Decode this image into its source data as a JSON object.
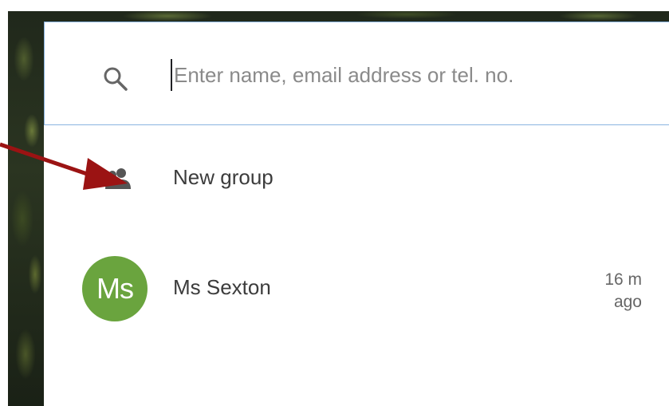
{
  "search": {
    "placeholder": "Enter name, email address or tel. no."
  },
  "new_group": {
    "label": "New group",
    "icon": "group-icon"
  },
  "contacts": [
    {
      "initials": "Ms",
      "name": "Ms Sexton",
      "time_line1": "16 m",
      "time_line2": "ago",
      "avatar_color": "#6aa43e"
    }
  ],
  "colors": {
    "accent_border": "#8ab4e0",
    "annotation_arrow": "#9b1313"
  }
}
